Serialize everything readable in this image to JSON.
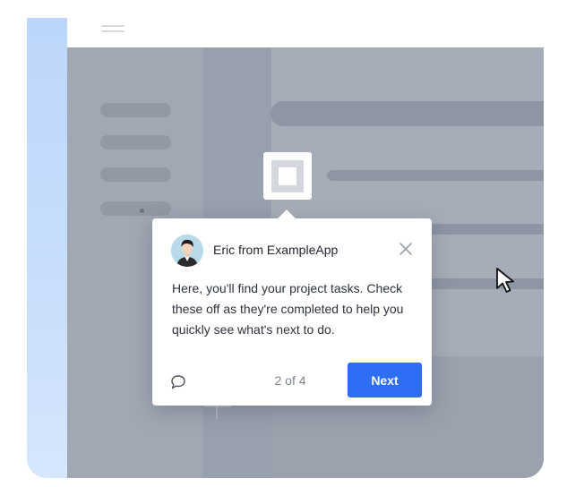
{
  "tour": {
    "sender": "Eric from ExampleApp",
    "message": "Here, you'll find your project tasks. Check these off as they're completed to help you quickly see what's next to do.",
    "progress": "2 of 4",
    "next_label": "Next"
  },
  "icons": {
    "menu": "hamburger-menu-icon",
    "close": "close-icon",
    "comment": "speech-bubble-icon",
    "cursor": "mouse-pointer-icon",
    "spotlight": "square-icon"
  },
  "colors": {
    "accent": "#2e6ef5",
    "rail": "#bcd6fb",
    "overlay": "#99a0ad"
  }
}
